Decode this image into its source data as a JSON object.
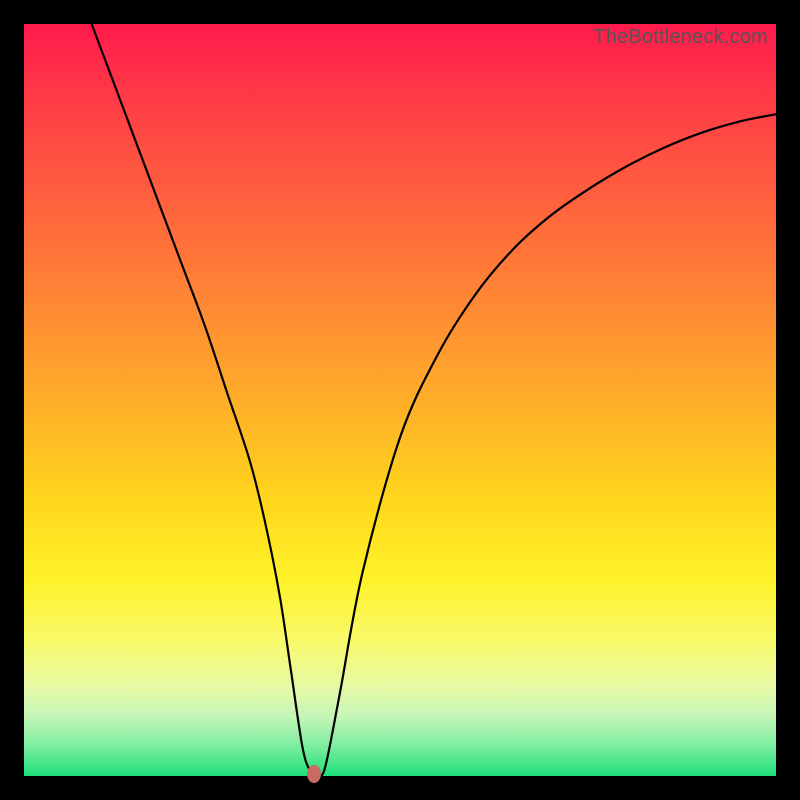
{
  "watermark": "TheBottleneck.com",
  "colors": {
    "frame": "#000000",
    "curve": "#000000",
    "marker": "#c96a63"
  },
  "chart_data": {
    "type": "line",
    "title": "",
    "xlabel": "",
    "ylabel": "",
    "xlim": [
      0,
      100
    ],
    "ylim": [
      0,
      100
    ],
    "grid": false,
    "legend": false,
    "series": [
      {
        "name": "bottleneck-curve",
        "x": [
          9,
          12,
          15,
          18,
          21,
          24,
          27,
          30,
          32,
          34,
          35.5,
          37,
          38,
          39,
          40,
          42,
          45,
          50,
          55,
          60,
          65,
          70,
          75,
          80,
          85,
          90,
          95,
          100
        ],
        "values": [
          100,
          92,
          84,
          76,
          68,
          60,
          51,
          42,
          34,
          24,
          14,
          4,
          0.8,
          0.5,
          1,
          11,
          27,
          45,
          56,
          64,
          70,
          74.5,
          78,
          81,
          83.5,
          85.5,
          87,
          88
        ]
      }
    ],
    "marker": {
      "x": 38.5,
      "y": 0.3
    }
  }
}
